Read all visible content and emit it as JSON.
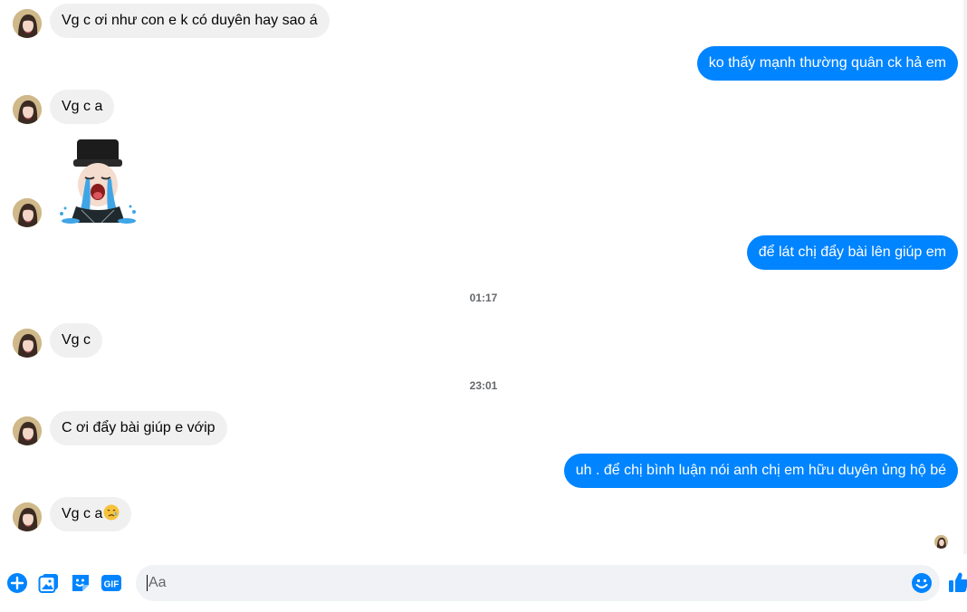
{
  "conversation": {
    "messages": [
      {
        "sender": "them",
        "text": "Vg c ơi như con e k có duyên hay sao á"
      },
      {
        "sender": "me",
        "text": "ko thấy mạnh thường quân ck hả em"
      },
      {
        "sender": "them",
        "text": "Vg c a"
      },
      {
        "sender": "them",
        "sticker": "crying-sticker"
      },
      {
        "sender": "me",
        "text": "để lát chị đẩy bài lên giúp em"
      },
      {
        "sender": "them",
        "text": "Vg c"
      },
      {
        "sender": "them",
        "text": "C ơi đẩy bài giúp e vớip"
      },
      {
        "sender": "me",
        "text": "uh . để chị bình luận nói anh chị em hữu duyên ủng hộ bé"
      },
      {
        "sender": "them",
        "text": "Vg c a",
        "emoji": "sad-relieved-face"
      }
    ],
    "timestamps": [
      "01:17",
      "23:01"
    ],
    "colors": {
      "outgoing": "#0084ff",
      "incoming": "#f0f0f0",
      "accent": "#0084ff"
    }
  },
  "composer": {
    "placeholder": "Aa",
    "icons": [
      "plus-icon",
      "image-icon",
      "sticker-icon",
      "gif-icon",
      "emoji-icon",
      "thumbs-up-icon"
    ],
    "gif_label": "GIF"
  }
}
